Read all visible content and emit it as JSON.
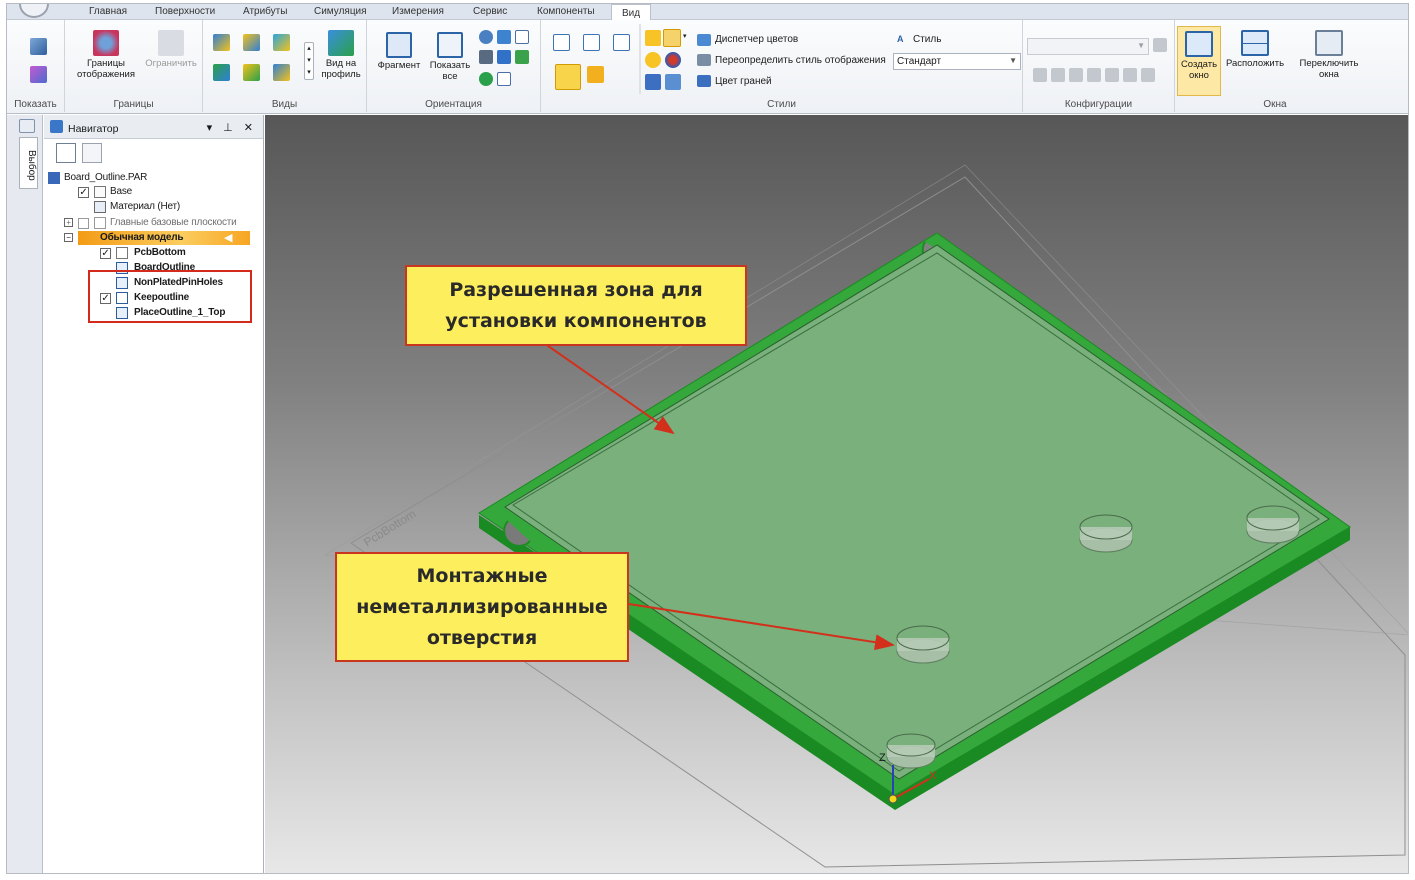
{
  "tabs": [
    "Главная",
    "Поверхности",
    "Атрибуты",
    "Симуляция",
    "Измерения",
    "Сервис",
    "Компоненты",
    "Вид"
  ],
  "active_tab": "Вид",
  "ribbon": {
    "show_group": {
      "label": "Показать"
    },
    "bounds_group": {
      "label": "Границы",
      "display_bounds": "Границы\nотображения",
      "restrict": "Ограничить"
    },
    "views_group": {
      "label": "Виды",
      "profile_view": "Вид на\nпрофиль"
    },
    "orientation_group": {
      "label": "Ориентация",
      "fragment": "Фрагмент",
      "show_all": "Показать\nвсе"
    },
    "styles_group": {
      "label": "Стили",
      "color_manager": "Диспетчер цветов",
      "override_style": "Переопределить стиль отображения",
      "face_color": "Цвет граней",
      "style_label": "Стиль",
      "style_value": "Стандарт"
    },
    "config_group": {
      "label": "Конфигурации",
      "config_value": ""
    },
    "windows_group": {
      "label": "Окна",
      "create_window": "Создать\nокно",
      "arrange": "Расположить",
      "switch_windows": "Переключить\nокна"
    }
  },
  "side_tab": "Выбор",
  "navigator": {
    "title": "Навигатор",
    "controls": "▾ ⊥ ✕",
    "tree": [
      {
        "label": "Board_Outline.PAR"
      },
      {
        "label": "Base"
      },
      {
        "label": "Материал (Нет)"
      },
      {
        "label": "Главные базовые плоскости"
      },
      {
        "label": "Обычная модель"
      },
      {
        "label": "PcbBottom"
      },
      {
        "label": "BoardOutline"
      },
      {
        "label": "NonPlatedPinHoles"
      },
      {
        "label": "Keepoutline"
      },
      {
        "label": "PlaceOutline_1_Top"
      }
    ]
  },
  "viewport": {
    "plane_label": "PcbBottom",
    "axis_z": "Z",
    "axis_x": "X",
    "callout_top": [
      "Разрешенная зона для",
      "установки компонентов"
    ],
    "callout_bottom": [
      "Монтажные",
      "неметаллизированные",
      "отверстия"
    ],
    "colors": {
      "board_green": "#3aa63f",
      "board_edge": "#1c8b22",
      "fill_green": "#79b07c",
      "callout_fill": "#fcee5c",
      "callout_border": "#c9361f",
      "arrow": "#d3301c"
    }
  }
}
